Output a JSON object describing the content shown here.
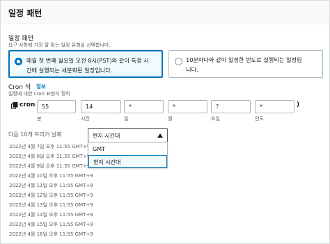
{
  "header": {
    "title": "일정 패턴"
  },
  "pattern": {
    "label": "일정 패턴",
    "description": "요구 사항에 가장 잘 맞는 일정 유형을 선택합니다.",
    "options": [
      {
        "line1": "매월 첫 번째 월요일 오전 8시(PST)와 같이 특정 시",
        "line2": "간에 실행되는 세분화된 일정입니다.",
        "selected": true
      },
      {
        "line1": "10분마다와 같이 일정한 빈도로 실행되는 일정입",
        "line2": "니다.",
        "selected": false
      }
    ]
  },
  "cron": {
    "label": "Cron 식",
    "info": "정보",
    "description": "일정에 대한 cron 표현식 정의",
    "prefix": "cron (",
    "suffix": ")",
    "fields": [
      {
        "value": "55",
        "caption": "분"
      },
      {
        "value": "14",
        "caption": "시간"
      },
      {
        "value": "*",
        "caption": "일"
      },
      {
        "value": "*",
        "caption": "월"
      },
      {
        "value": "?",
        "caption": "요일"
      },
      {
        "value": "*",
        "caption": "연도"
      }
    ]
  },
  "triggers": {
    "label": "다음 10개 트리거 날짜",
    "timezone_selected": "현지 시간대",
    "timezone_options": [
      "GMT",
      "현지 시간대"
    ],
    "dates": [
      "2022년 4월 7일 오후 11:55 GMT+9",
      "2022년 4월 8일 오후 11:55 GMT+9",
      "2022년 4월 9일 오후 11:55 GMT+9",
      "2022년 4월 10일 오후 11:55 GMT+9",
      "2022년 4월 11일 오후 11:55 GMT+9",
      "2022년 4월 12일 오후 11:55 GMT+9",
      "2022년 4월 13일 오후 11:55 GMT+9",
      "2022년 4월 14일 오후 11:55 GMT+9",
      "2022년 4월 15일 오후 11:55 GMT+9",
      "2022년 4월 16일 오후 11:55 GMT+9"
    ]
  },
  "colors": {
    "accent": "#0073bb",
    "selected_bg": "#f1faff",
    "border": "#aab7b8"
  }
}
